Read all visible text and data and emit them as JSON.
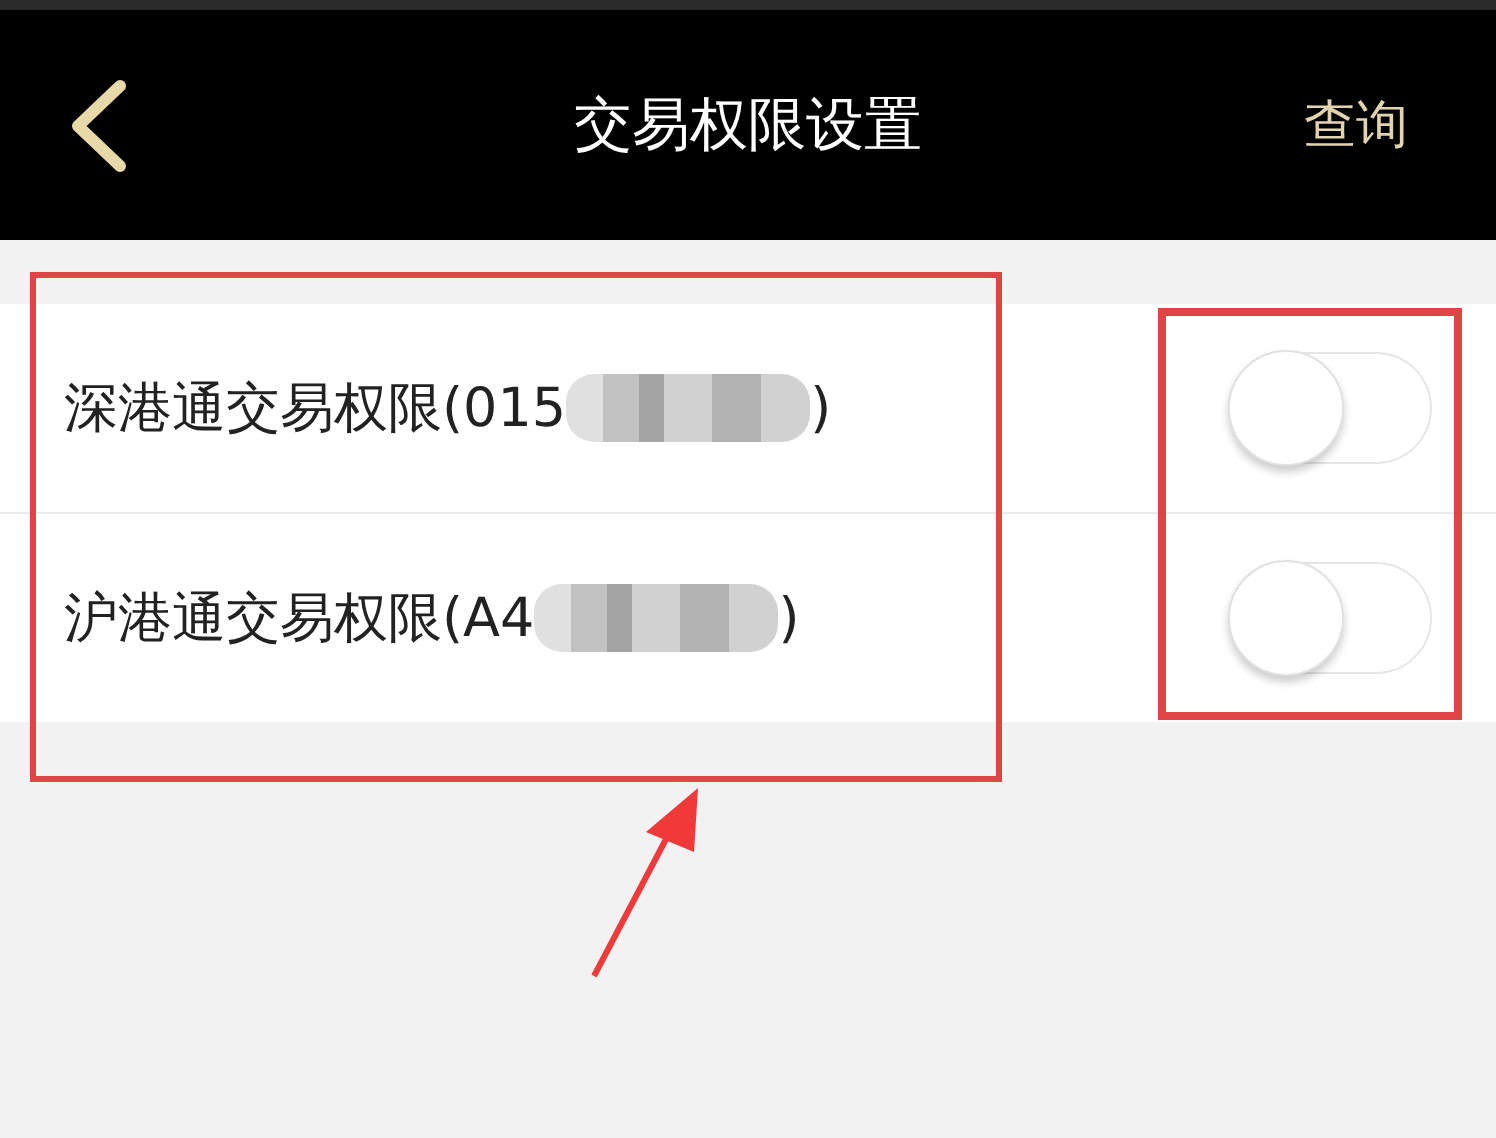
{
  "header": {
    "title": "交易权限设置",
    "action": "查询"
  },
  "settings": [
    {
      "label_start": "深港通交易权限(015",
      "label_end": ")",
      "on": false
    },
    {
      "label_start": "沪港通交易权限(A4",
      "label_end": ")",
      "on": false
    }
  ]
}
